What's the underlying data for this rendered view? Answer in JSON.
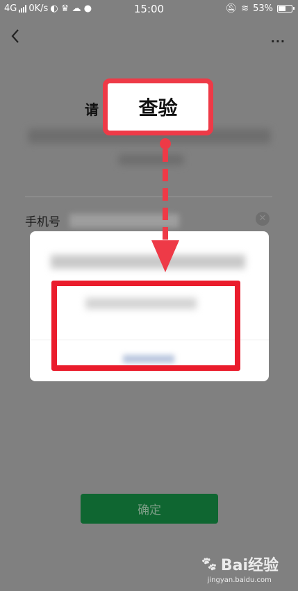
{
  "status_bar": {
    "network": "4G",
    "speed": "0K/s",
    "time": "15:00",
    "battery": "53%",
    "battery_level": 0.53
  },
  "nav": {
    "more_label": "···"
  },
  "page": {
    "heading": "请",
    "phone_label": "手机号",
    "confirm_label": "确定"
  },
  "annotation": {
    "callout": "查验",
    "color": "#ee3a47"
  },
  "watermark": {
    "brand": "Bai经验",
    "site": "jingyan.baidu.com"
  }
}
